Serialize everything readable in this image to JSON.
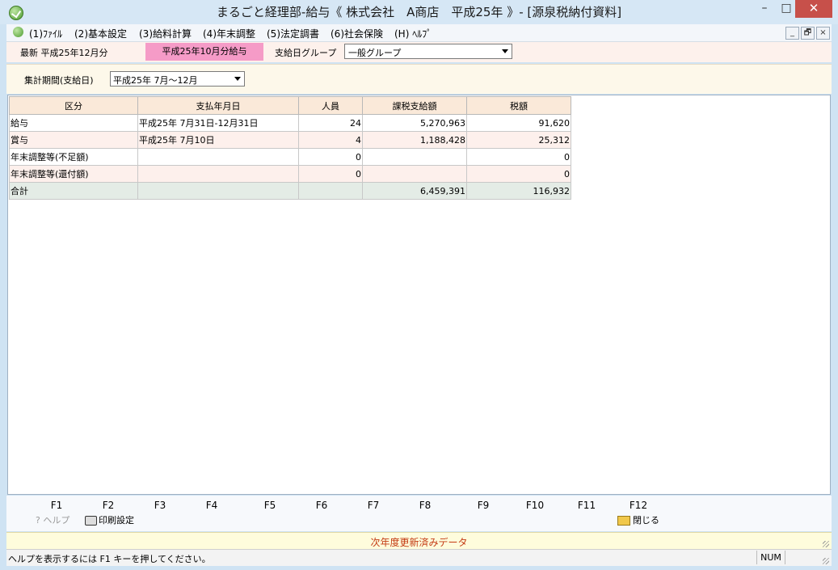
{
  "window": {
    "title": "まるごと経理部-給与《 株式会社　A商店　平成25年 》- [源泉税納付資料]",
    "minimize": "–",
    "maximize": "□",
    "close": "✕"
  },
  "menu": {
    "items": [
      "(1)ﾌｧｲﾙ",
      "(2)基本設定",
      "(3)給料計算",
      "(4)年末調整",
      "(5)法定調書",
      "(6)社会保険",
      "(H) ﾍﾙﾌﾟ"
    ],
    "mdi_minimize": "_",
    "mdi_restore": "🗗",
    "mdi_close": "×"
  },
  "header": {
    "latest": "最新 平成25年12月分",
    "current_tab": "平成25年10月分給与",
    "group_label": "支給日グループ",
    "group_value": "一般グループ"
  },
  "period": {
    "label": "集計期間(支給日)",
    "value": "平成25年 7月～12月"
  },
  "grid": {
    "columns": [
      "区分",
      "支払年月日",
      "人員",
      "課税支給額",
      "税額"
    ],
    "rows": [
      {
        "category": "給与",
        "date": "平成25年 7月31日-12月31日",
        "count": "24",
        "taxable": "5,270,963",
        "tax": "91,620"
      },
      {
        "category": "賞与",
        "date": "平成25年 7月10日",
        "count": "4",
        "taxable": "1,188,428",
        "tax": "25,312"
      },
      {
        "category": "年末調整等(不足額)",
        "date": "",
        "count": "0",
        "taxable": "",
        "tax": "0"
      },
      {
        "category": "年末調整等(還付額)",
        "date": "",
        "count": "0",
        "taxable": "",
        "tax": "0"
      },
      {
        "category": "合計",
        "date": "",
        "count": "",
        "taxable": "6,459,391",
        "tax": "116,932"
      }
    ]
  },
  "fkeys": {
    "keys": [
      "F1",
      "F2",
      "F3",
      "F4",
      "F5",
      "F6",
      "F7",
      "F8",
      "F9",
      "F10",
      "F11",
      "F12"
    ],
    "help_label": "ヘルプ",
    "print_label": "印刷設定",
    "close_label": "閉じる"
  },
  "notice": "次年度更新済みデータ",
  "status": {
    "text": "ヘルプを表示するには F1 キーを押してください。",
    "num": "NUM"
  }
}
